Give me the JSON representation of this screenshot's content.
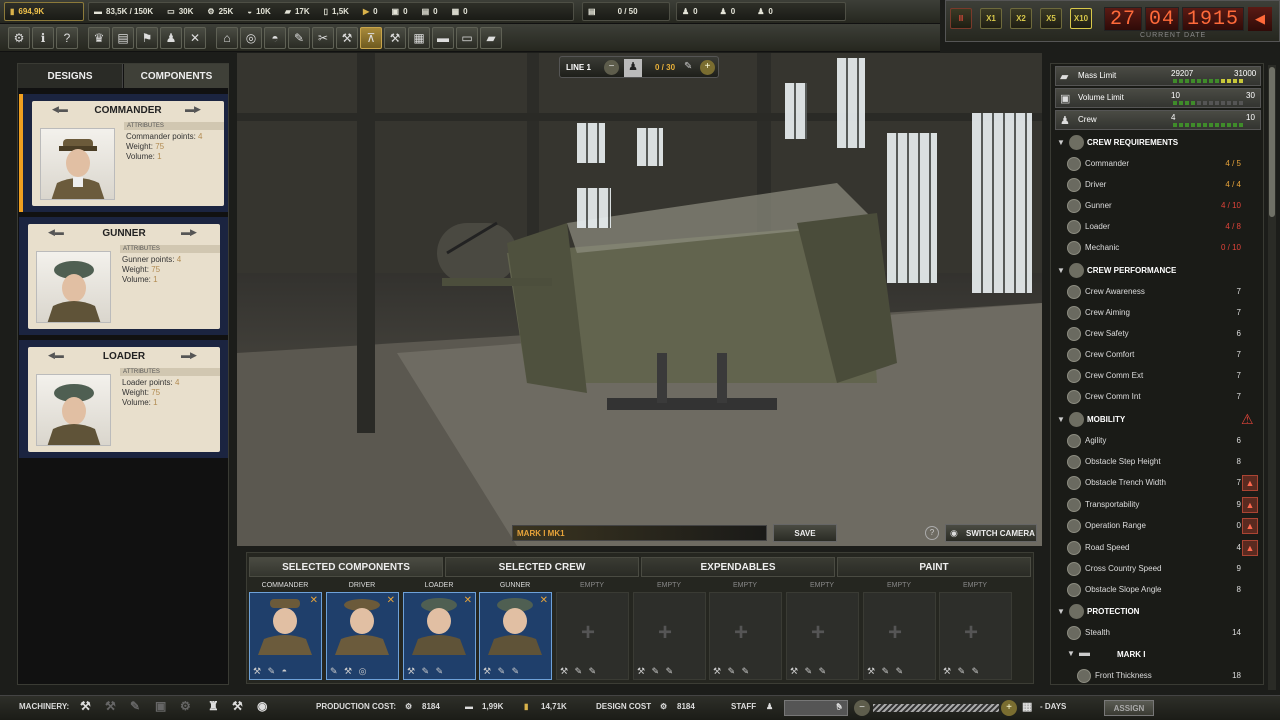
{
  "resources": {
    "money": "694,9K",
    "r1": "83,5K / 150K",
    "r2": "30K",
    "r3": "25K",
    "r4": "10K",
    "r5": "17K",
    "r6": "1,5K",
    "r7": "0",
    "r8": "0",
    "r9": "0",
    "r10": "0",
    "storage": "0 / 50",
    "staff1": "0",
    "staff2": "0",
    "staff3": "0"
  },
  "speed_buttons": [
    "II",
    "X1",
    "X2",
    "X5",
    "X10"
  ],
  "date": {
    "day": "27",
    "month": "04",
    "year": "1915",
    "label": "CURRENT DATE"
  },
  "left_tabs": {
    "designs": "DESIGNS",
    "components": "COMPONENTS"
  },
  "cards": [
    {
      "title": "COMMANDER",
      "attributes": "ATTRIBUTES",
      "points_label": "Commander points:",
      "points": "4",
      "weight_label": "Weight:",
      "weight": "75",
      "volume_label": "Volume:",
      "volume": "1"
    },
    {
      "title": "GUNNER",
      "attributes": "ATTRIBUTES",
      "points_label": "Gunner points:",
      "points": "4",
      "weight_label": "Weight:",
      "weight": "75",
      "volume_label": "Volume:",
      "volume": "1"
    },
    {
      "title": "LOADER",
      "attributes": "ATTRIBUTES",
      "points_label": "Loader points:",
      "points": "4",
      "weight_label": "Weight:",
      "weight": "75",
      "volume_label": "Volume:",
      "volume": "1"
    }
  ],
  "line": {
    "label": "LINE 1",
    "count": "0 / 30"
  },
  "design_name": "MARK I MK1",
  "save_label": "SAVE",
  "switch_camera_label": "SWITCH CAMERA",
  "bottom_tabs": [
    "SELECTED COMPONENTS",
    "SELECTED CREW",
    "EXPENDABLES",
    "PAINT"
  ],
  "slot_labels": [
    "COMMANDER",
    "DRIVER",
    "LOADER",
    "GUNNER",
    "EMPTY",
    "EMPTY",
    "EMPTY",
    "EMPTY",
    "EMPTY",
    "EMPTY"
  ],
  "limits": [
    {
      "label": "Mass Limit",
      "value": "29207",
      "max": "31000"
    },
    {
      "label": "Volume Limit",
      "value": "10",
      "max": "30"
    },
    {
      "label": "Crew",
      "value": "4",
      "max": "10"
    }
  ],
  "crew_requirements": {
    "title": "CREW REQUIREMENTS",
    "items": [
      {
        "name": "Commander",
        "value": "4 / 5",
        "color": "#e8a43a"
      },
      {
        "name": "Driver",
        "value": "4 / 4",
        "color": "#e8a43a"
      },
      {
        "name": "Gunner",
        "value": "4 / 10",
        "color": "#e0443a"
      },
      {
        "name": "Loader",
        "value": "4 / 8",
        "color": "#e0443a"
      },
      {
        "name": "Mechanic",
        "value": "0 / 10",
        "color": "#e0443a"
      }
    ]
  },
  "crew_performance": {
    "title": "CREW PERFORMANCE",
    "items": [
      {
        "name": "Crew Awareness",
        "value": "7"
      },
      {
        "name": "Crew Aiming",
        "value": "7"
      },
      {
        "name": "Crew Safety",
        "value": "6"
      },
      {
        "name": "Crew Comfort",
        "value": "7"
      },
      {
        "name": "Crew Comm Ext",
        "value": "7"
      },
      {
        "name": "Crew Comm Int",
        "value": "7"
      }
    ]
  },
  "mobility": {
    "title": "MOBILITY",
    "items": [
      {
        "name": "Agility",
        "value": "6",
        "warn": false
      },
      {
        "name": "Obstacle Step Height",
        "value": "8",
        "warn": false
      },
      {
        "name": "Obstacle Trench Width",
        "value": "7",
        "warn": true
      },
      {
        "name": "Transportability",
        "value": "9",
        "warn": true
      },
      {
        "name": "Operation Range",
        "value": "0",
        "warn": true
      },
      {
        "name": "Road Speed",
        "value": "4",
        "warn": true
      },
      {
        "name": "Cross Country Speed",
        "value": "9",
        "warn": false
      },
      {
        "name": "Obstacle Slope Angle",
        "value": "8",
        "warn": false
      }
    ]
  },
  "protection": {
    "title": "PROTECTION",
    "stealth": {
      "name": "Stealth",
      "value": "14"
    },
    "tank_name": "MARK I",
    "front": {
      "name": "Front Thickness",
      "value": "18"
    }
  },
  "bottom": {
    "machinery": "MACHINERY:",
    "production_cost": "PRODUCTION COST:",
    "pc1": "8184",
    "pc2": "1,99K",
    "pc3": "14,71K",
    "design_cost": "DESIGN COST",
    "dc": "8184",
    "staff": "STAFF",
    "staff_value": "0",
    "days": "- DAYS",
    "assign": "ASSIGN"
  }
}
